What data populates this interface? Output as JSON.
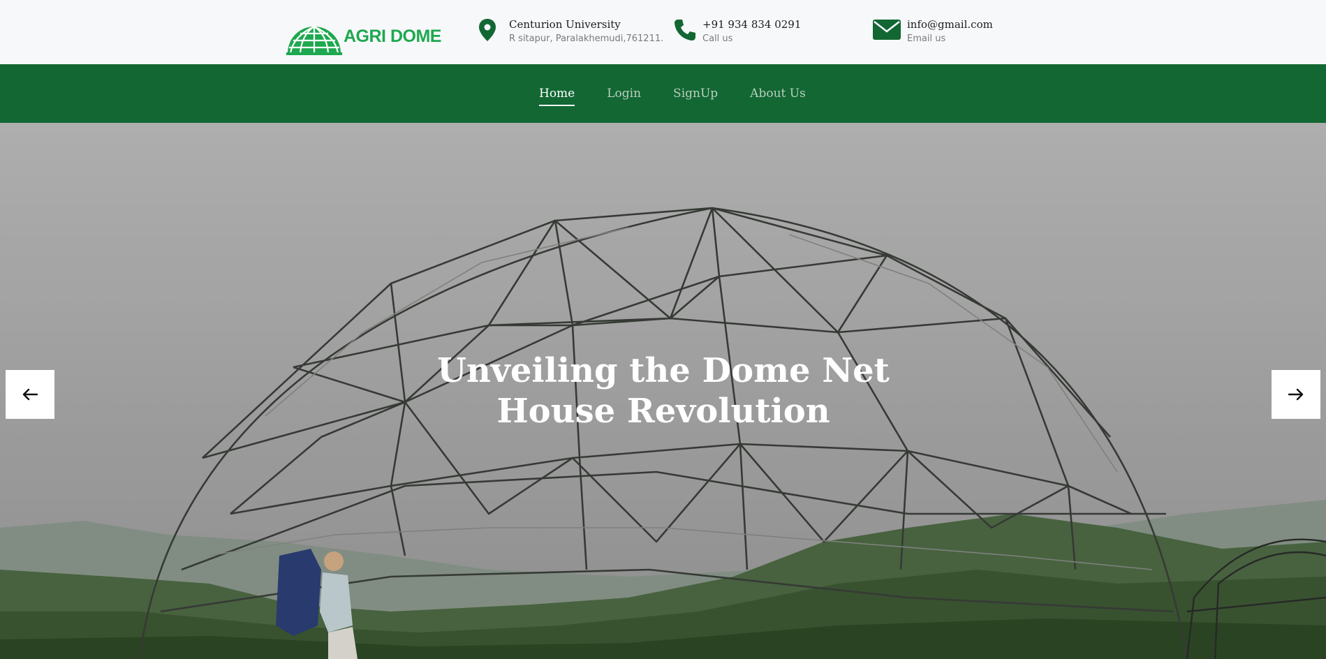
{
  "brand": {
    "name": "AGRI DOME",
    "color": "#1ea84f",
    "logo_icon": "dome-globe-icon"
  },
  "contact": {
    "address": {
      "icon": "map-pin-icon",
      "title": "Centurion University",
      "subtitle": "R sitapur, Paralakhemudi,761211."
    },
    "phone": {
      "icon": "phone-icon",
      "title": "+91 934 834 0291",
      "subtitle": "Call us"
    },
    "email": {
      "icon": "envelope-icon",
      "title": "info@gmail.com",
      "subtitle": "Email us"
    }
  },
  "nav": {
    "color": "#126733",
    "items": [
      {
        "label": "Home",
        "active": true
      },
      {
        "label": "Login",
        "active": false
      },
      {
        "label": "SignUp",
        "active": false
      },
      {
        "label": "About Us",
        "active": false
      }
    ]
  },
  "hero": {
    "title_line1": "Unveiling the Dome Net",
    "title_line2": "House Revolution",
    "prev_icon": "arrow-left-icon",
    "next_icon": "arrow-right-icon"
  }
}
